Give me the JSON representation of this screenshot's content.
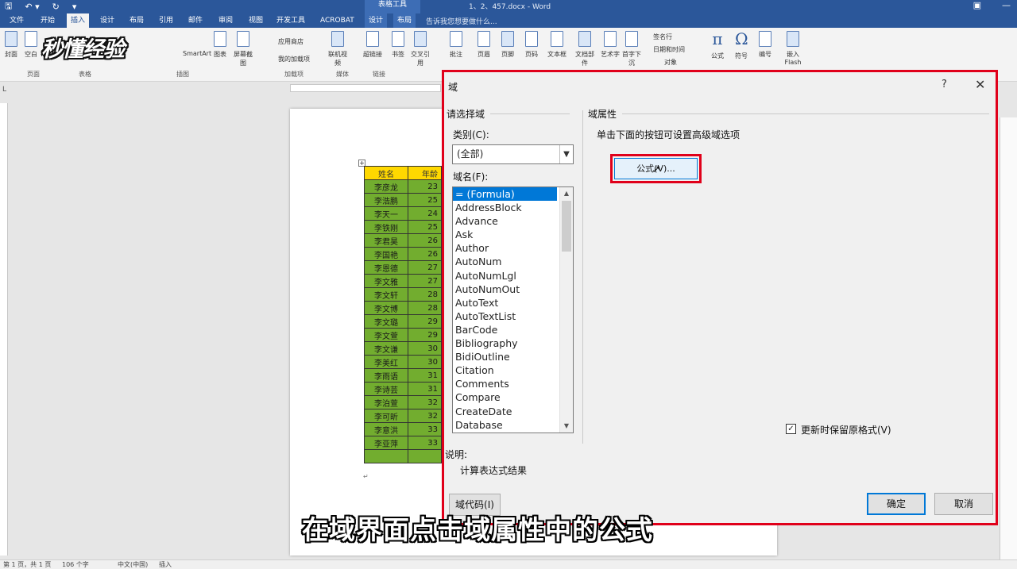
{
  "titlebar": {
    "contextual_label": "表格工具",
    "doc_title": "1、2、457.docx - Word",
    "tell_me": "告诉我您想要做什么..."
  },
  "tabs": [
    "文件",
    "开始",
    "插入",
    "设计",
    "布局",
    "引用",
    "邮件",
    "审阅",
    "视图",
    "开发工具",
    "ACROBAT"
  ],
  "context_tabs": [
    "设计",
    "布局"
  ],
  "active_tab": "插入",
  "ribbon": {
    "buttons": [
      "封面",
      "空白",
      "表格",
      "SmartArt",
      "图表",
      "屏幕截图",
      "联机视频",
      "超链接",
      "书签",
      "交叉引用",
      "批注",
      "页眉",
      "页脚",
      "页码",
      "文本框",
      "文档部件",
      "艺术字",
      "首字下沉",
      "公式",
      "符号",
      "编号",
      "嵌入Flash"
    ],
    "small": [
      "应用商店",
      "我的加载项",
      "签名行",
      "日期和时间",
      "对象"
    ],
    "groups": [
      "页面",
      "表格",
      "插图",
      "加载项",
      "媒体",
      "链接",
      "批注",
      "页眉和页脚",
      "文本",
      "符号"
    ],
    "flash_sub": "Flash"
  },
  "watermark": "秒懂经验",
  "table": {
    "headers": [
      "姓名",
      "年龄"
    ],
    "rows": [
      [
        "李彦龙",
        "23"
      ],
      [
        "李浩鹏",
        "25"
      ],
      [
        "李天一",
        "24"
      ],
      [
        "李铁刚",
        "25"
      ],
      [
        "李君昊",
        "26"
      ],
      [
        "李国艳",
        "26"
      ],
      [
        "李恩德",
        "27"
      ],
      [
        "李文雅",
        "27"
      ],
      [
        "李文轩",
        "28"
      ],
      [
        "李文博",
        "28"
      ],
      [
        "李文璐",
        "29"
      ],
      [
        "李文萱",
        "29"
      ],
      [
        "李文谦",
        "30"
      ],
      [
        "李美红",
        "30"
      ],
      [
        "李雨语",
        "31"
      ],
      [
        "李诗芸",
        "31"
      ],
      [
        "李泊萱",
        "32"
      ],
      [
        "李可昕",
        "32"
      ],
      [
        "李意洪",
        "33"
      ],
      [
        "李亚萍",
        "33"
      ],
      [
        "",
        ""
      ]
    ]
  },
  "statusbar": {
    "page": "第 1 页，共 1 页",
    "words": "106 个字",
    "language": "中文(中国)",
    "mode": "插入"
  },
  "dialog": {
    "title": "域",
    "help": "?",
    "close": "✕",
    "select_field_label": "请选择域",
    "category_label": "类别(C):",
    "category_value": "(全部)",
    "field_names_label": "域名(F):",
    "field_names": [
      "= (Formula)",
      "AddressBlock",
      "Advance",
      "Ask",
      "Author",
      "AutoNum",
      "AutoNumLgl",
      "AutoNumOut",
      "AutoText",
      "AutoTextList",
      "BarCode",
      "Bibliography",
      "BidiOutline",
      "Citation",
      "Comments",
      "Compare",
      "CreateDate",
      "Database"
    ],
    "selected_field": "= (Formula)",
    "properties_label": "域属性",
    "properties_hint": "单击下面的按钮可设置高级域选项",
    "formula_button": "公式(V)...",
    "preserve_format": "更新时保留原格式(V)",
    "preserve_checked": true,
    "description_label": "说明:",
    "description": "计算表达式结果",
    "field_codes_button": "域代码(I)",
    "ok_button": "确定",
    "cancel_button": "取消"
  },
  "subtitle": "在域界面点击域属性中的公式",
  "colors": {
    "word_blue": "#2b579a",
    "highlight_red": "#e0001a",
    "header_yellow": "#ffd800",
    "row_green": "#72ad2f",
    "selection_blue": "#0078d7"
  }
}
